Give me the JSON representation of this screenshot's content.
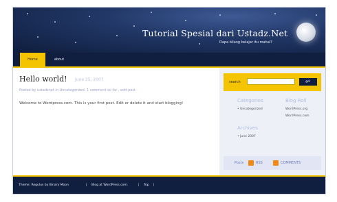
{
  "header": {
    "site_title": "Tutorial Spesial dari Ustadz.Net",
    "tagline": "Dapa bilang belajar itu mahal?"
  },
  "nav": {
    "items": [
      "Home",
      "about"
    ]
  },
  "post": {
    "title": "Hello world!",
    "date": "June 25, 2007",
    "meta": "Posted by ustadznet in Uncategorized. 1 comment so far , edit post",
    "body": "Welcome to Wordpress.com. This is your first post. Edit or delete it and start blogging!"
  },
  "sidebar": {
    "search_label": "search",
    "search_button": "go!",
    "categories_title": "Categories",
    "categories": [
      "Uncategorized"
    ],
    "blogroll_title": "Blog Roll",
    "blogroll": [
      "WordPress.org",
      "WordPress.com"
    ],
    "archives_title": "Archives",
    "archives": [
      "June 2007"
    ],
    "feeds": {
      "label": "Posts",
      "rss": "RSS",
      "comments": "COMMENTS"
    }
  },
  "footer": {
    "links": [
      "Theme: Regulus by Binary Moon",
      "Blog at WordPress.com.",
      "Top"
    ]
  },
  "colors": {
    "accent": "#f5c400",
    "navy": "#101f40",
    "header_blue": "#223868"
  }
}
